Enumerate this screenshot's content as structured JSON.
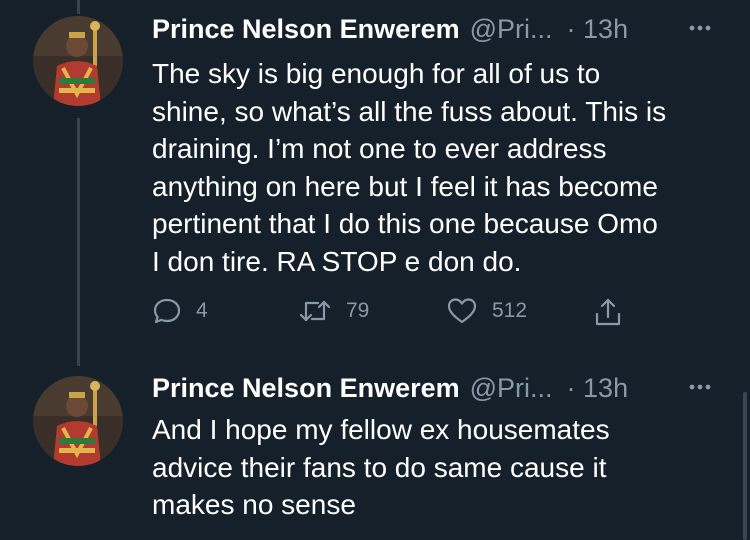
{
  "colors": {
    "background": "#15202b",
    "text_primary": "#ffffff",
    "text_secondary": "#8899a6",
    "thread_line": "#38444d"
  },
  "tweets": [
    {
      "author_name": "Prince Nelson Enwerem",
      "handle": "@Pri...",
      "time": "· 13h",
      "more_icon": "ellipsis-icon",
      "lines": [
        "The sky is big enough for all of us to",
        "shine, so what’s all the fuss about. This is",
        "draining. I’m not one to ever address",
        "anything on here but I feel it has become",
        "pertinent that I do this one because Omo",
        "I don tire. RA STOP e don do."
      ],
      "actions": {
        "replies": "4",
        "retweets": "79",
        "likes": "512"
      }
    },
    {
      "author_name": "Prince Nelson Enwerem",
      "handle": "@Pri...",
      "time": "· 13h",
      "more_icon": "ellipsis-icon",
      "lines": [
        "And I hope my fellow ex housemates",
        "advice their fans to do same cause it",
        "makes no sense"
      ]
    }
  ]
}
